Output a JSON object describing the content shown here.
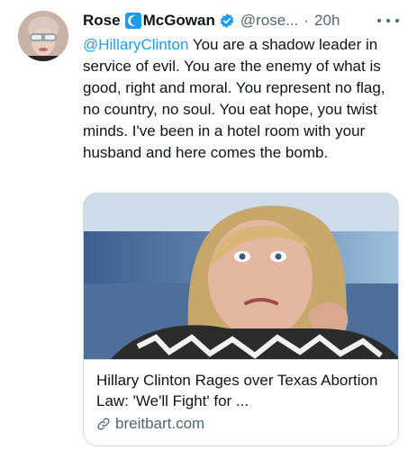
{
  "tweet": {
    "display_name_part1": "Rose",
    "display_name_part2": "McGowan",
    "handle": "@rose...",
    "time_separator": "·",
    "time": "20h",
    "mention": "@HillaryClinton",
    "body": " You are a shadow leader in service of evil. You are the enemy of what is good, right and moral. You represent no flag, no country, no soul. You eat hope, you twist minds. I've been in a hotel room with your husband and here comes the bomb."
  },
  "card": {
    "title": "Hillary Clinton Rages over Texas Abortion Law: 'We'll Fight' for ...",
    "domain": "breitbart.com"
  },
  "icons": {
    "moon": "crescent-moon-icon",
    "verified": "verified-badge-icon",
    "more": "more-options-icon",
    "link": "link-icon"
  },
  "colors": {
    "accent": "#1d9bf0",
    "secondary_text": "#536471",
    "border": "#cfd9de"
  }
}
